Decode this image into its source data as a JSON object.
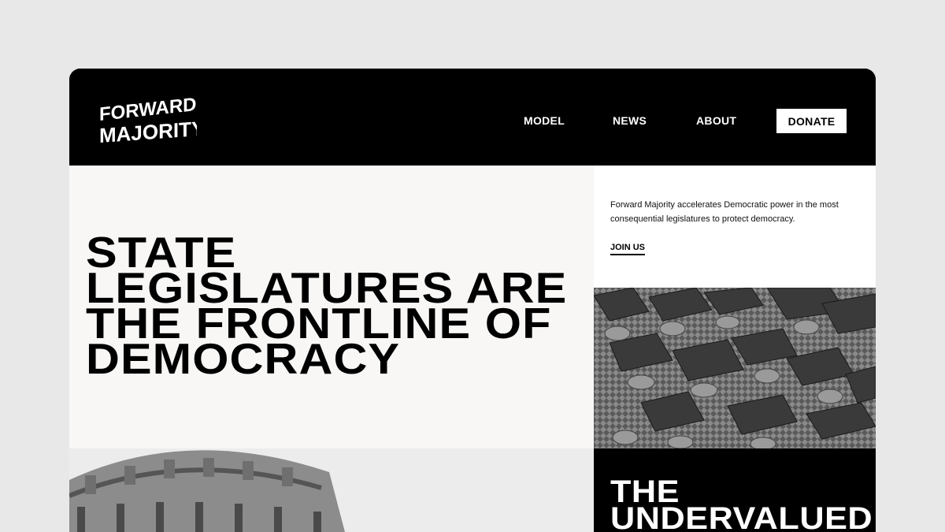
{
  "brand": {
    "logo_line1": "FORWARD",
    "logo_line2": "MAJORITY"
  },
  "nav": {
    "model": "MODEL",
    "news": "NEWS",
    "about": "ABOUT",
    "donate": "DONATE"
  },
  "hero": {
    "headline_lines": [
      "STATE",
      "LEGISLATURES ARE",
      "THE FRONTLINE OF",
      "DEMOCRACY"
    ],
    "intro": "Forward Majority accelerates Democratic power in the most consequential legislatures to protect democracy.",
    "cta": "JOIN US"
  },
  "section": {
    "title_lines": [
      "THE",
      "UNDERVALUED"
    ]
  },
  "images": {
    "chamber": "legislative-chamber-desks-photo",
    "capitol": "capitol-dome-photo"
  },
  "colors": {
    "header_bg": "#000000",
    "hero_bg": "#f8f7f5",
    "text": "#000000",
    "accent": "#ffffff"
  }
}
